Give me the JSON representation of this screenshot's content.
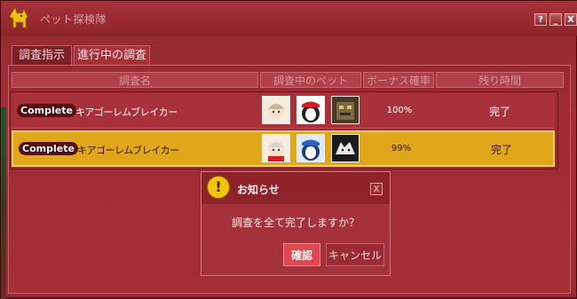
{
  "window": {
    "title": "ペット探検隊"
  },
  "title_buttons": {
    "help": "?",
    "minimize": "_",
    "close": "X"
  },
  "tabs": [
    {
      "label": "調査指示",
      "active": false
    },
    {
      "label": "進行中の調査",
      "active": true
    }
  ],
  "columns": [
    "調査名",
    "調査中のペット",
    "ボーナス確率",
    "残り時間"
  ],
  "rows": [
    {
      "badge": "Complete",
      "name": "キアゴーレムブレイカー",
      "pets": [
        "pet-avatar-icon",
        "penguin-red-icon",
        "golem-icon"
      ],
      "rate": "100%",
      "status": "完了",
      "selected": false
    },
    {
      "badge": "Complete",
      "name": "キアゴーレムブレイカー",
      "pets": [
        "pet-avatar-icon",
        "penguin-blue-icon",
        "wolf-icon"
      ],
      "rate": "99%",
      "status": "完了",
      "selected": true
    }
  ],
  "dialog": {
    "title": "お知らせ",
    "close": "X",
    "icon": "!",
    "message": "調査を全て完了しますか？",
    "confirm": "確認",
    "cancel": "キャンセル"
  },
  "colors": {
    "window": "#a52e36",
    "selected_row": "#e0a71a",
    "dialog": "#b23a42",
    "confirm_button": "#e0474f"
  }
}
